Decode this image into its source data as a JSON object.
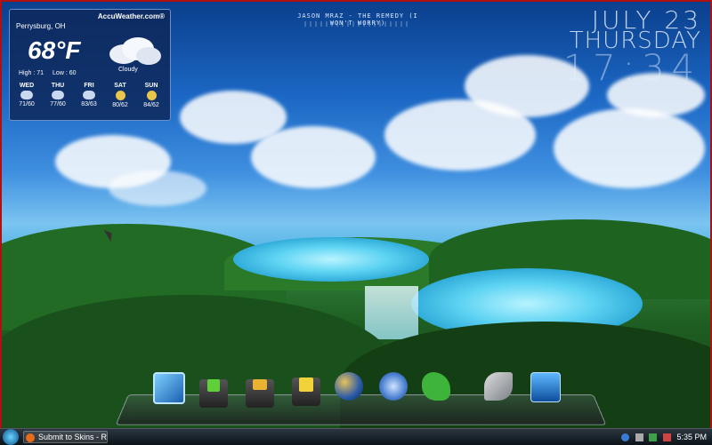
{
  "weather": {
    "brand": "AccuWeather.com®",
    "location": "Perrysburg, OH",
    "temperature": "68",
    "unit": "°F",
    "condition": "Cloudy",
    "high": "High : 71",
    "low": "Low : 60",
    "forecast": [
      {
        "day": "WED",
        "temps": "71/60",
        "icon": "rain-cloud-icon"
      },
      {
        "day": "THU",
        "temps": "77/60",
        "icon": "rain-cloud-icon"
      },
      {
        "day": "FRI",
        "temps": "83/63",
        "icon": "rain-cloud-icon"
      },
      {
        "day": "SAT",
        "temps": "80/62",
        "icon": "sun-icon"
      },
      {
        "day": "SUN",
        "temps": "84/62",
        "icon": "sun-icon"
      }
    ]
  },
  "now_playing": "JASON MRAZ - THE REMEDY (I WON'T WORRY)",
  "clock": {
    "date": "JULY 23",
    "day": "THURSDAY",
    "time": "17:34"
  },
  "dock": {
    "icons": [
      "computer-icon",
      "downloads-folder-icon",
      "pictures-folder-icon",
      "documents-folder-icon",
      "globe-icon",
      "itunes-icon",
      "game-dragon-icon",
      "tools-icon",
      "recycle-bin-icon"
    ]
  },
  "taskbar": {
    "task_label": "Submit to Skins - Ro...",
    "time": "5:35 PM"
  }
}
